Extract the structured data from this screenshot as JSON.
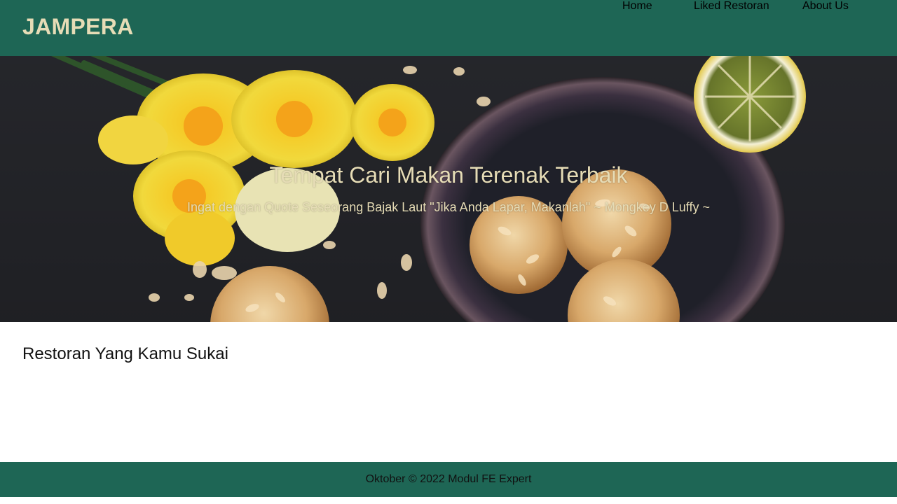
{
  "header": {
    "brand": "JAMPERA",
    "nav": {
      "home": "Home",
      "liked": "Liked Restoran",
      "about": "About Us"
    }
  },
  "hero": {
    "title": "Tempat Cari Makan Terenak Terbaik",
    "quote": "Ingat dengan Quote Seseorang Bajak Laut \"Jika Anda Lapar, Makanlah\" ~ Mongkey D Luffy ~",
    "image_subject": "cookies-flowers-lemon-still-life"
  },
  "main": {
    "section_title": "Restoran Yang Kamu Sukai"
  },
  "footer": {
    "text": "Oktober © 2022 Modul FE Expert"
  },
  "colors": {
    "primary": "#1e6655",
    "brand_text": "#e6dcb6",
    "hero_text": "#e6dcb6",
    "body_text": "#111111"
  }
}
